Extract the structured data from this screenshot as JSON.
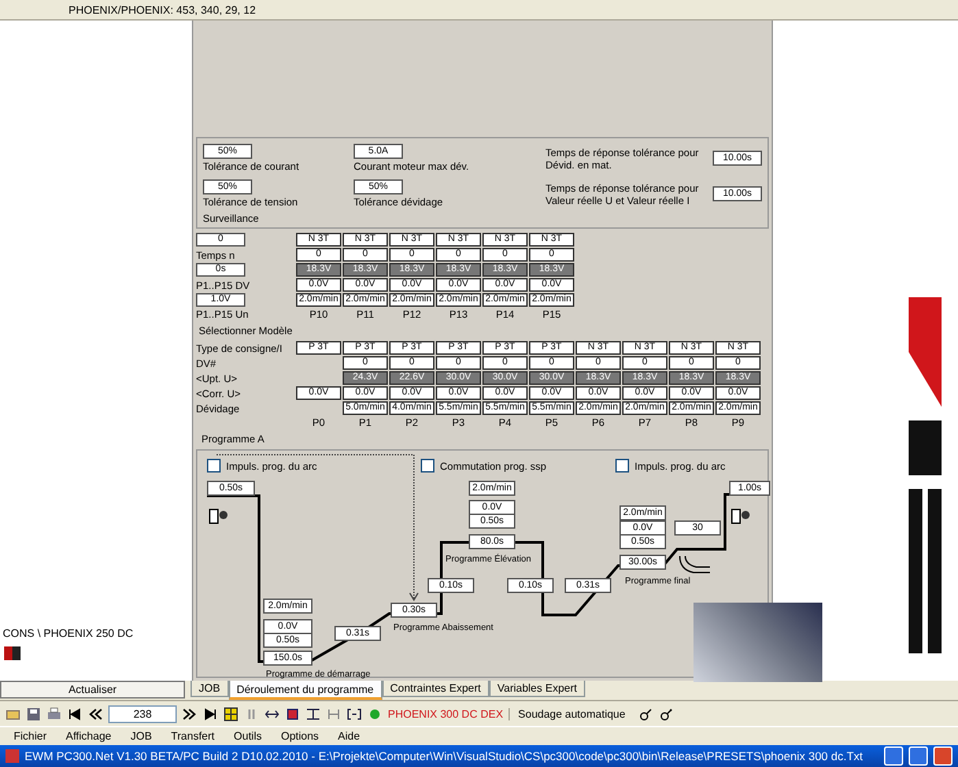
{
  "status_bar": {
    "text": "PHOENIX/PHOENIX: 453, 340, 29, 12"
  },
  "surveillance": {
    "title": "Surveillance",
    "fields": [
      {
        "label": "Tolérance de courant",
        "value": "50%"
      },
      {
        "label": "Courant moteur max dév.",
        "value": "5.0A"
      },
      {
        "label": "Temps de réponse tolérance pour Dévid. en mat.",
        "value": "10.00s"
      },
      {
        "label": "Tolérance de tension",
        "value": "50%"
      },
      {
        "label": "Tolérance dévidage",
        "value": "50%"
      },
      {
        "label": "Temps de réponse tolérance pour Valeur réelle U et Valeur réelle I",
        "value": "10.00s"
      }
    ]
  },
  "parameters_b": {
    "rows": [
      {
        "side": {
          "kind": "field",
          "text": "0"
        },
        "kind": "plain",
        "cells": [
          "N 3T",
          "N 3T",
          "N 3T",
          "N 3T",
          "N 3T",
          "N 3T"
        ]
      },
      {
        "side": {
          "kind": "label",
          "text": "Temps n"
        },
        "kind": "plain",
        "cells": [
          "0",
          "0",
          "0",
          "0",
          "0",
          "0"
        ]
      },
      {
        "side": {
          "kind": "field",
          "text": "0s"
        },
        "kind": "dark",
        "cells": [
          "18.3V",
          "18.3V",
          "18.3V",
          "18.3V",
          "18.3V",
          "18.3V"
        ]
      },
      {
        "side": {
          "kind": "label",
          "text": "P1..P15 DV"
        },
        "kind": "plain",
        "cells": [
          "0.0V",
          "0.0V",
          "0.0V",
          "0.0V",
          "0.0V",
          "0.0V"
        ]
      },
      {
        "side": {
          "kind": "field",
          "text": "1.0V"
        },
        "kind": "plain",
        "cells": [
          "2.0m/min",
          "2.0m/min",
          "2.0m/min",
          "2.0m/min",
          "2.0m/min",
          "2.0m/min"
        ]
      },
      {
        "side": {
          "kind": "label",
          "text": "P1..P15 Un"
        },
        "kind": "header",
        "cells": [
          "P10",
          "P11",
          "P12",
          "P13",
          "P14",
          "P15"
        ]
      }
    ]
  },
  "parameters": {
    "note": "Sélectionner Modèle",
    "rows": [
      {
        "label": "Type de consigne/I",
        "kind": "plain",
        "cells": [
          "P 3T",
          "P 3T",
          "P 3T",
          "P 3T",
          "P 3T",
          "P 3T",
          "N 3T",
          "N 3T",
          "N 3T",
          "N 3T"
        ]
      },
      {
        "label": "DV#",
        "kind": "plain",
        "cells": [
          null,
          "0",
          "0",
          "0",
          "0",
          "0",
          "0",
          "0",
          "0",
          "0"
        ]
      },
      {
        "label": "<Upt. U>",
        "kind": "dark",
        "cells": [
          null,
          "24.3V",
          "22.6V",
          "30.0V",
          "30.0V",
          "30.0V",
          "18.3V",
          "18.3V",
          "18.3V",
          "18.3V"
        ]
      },
      {
        "label": "<Corr. U>",
        "kind": "plain",
        "cells": [
          "0.0V",
          "0.0V",
          "0.0V",
          "0.0V",
          "0.0V",
          "0.0V",
          "0.0V",
          "0.0V",
          "0.0V",
          "0.0V"
        ]
      },
      {
        "label": "Dévidage",
        "kind": "plain",
        "cells": [
          null,
          "5.0m/min",
          "4.0m/min",
          "5.5m/min",
          "5.5m/min",
          "5.5m/min",
          "2.0m/min",
          "2.0m/min",
          "2.0m/min",
          "2.0m/min"
        ]
      },
      {
        "label": null,
        "kind": "header",
        "cells": [
          "P0",
          "P1",
          "P2",
          "P3",
          "P4",
          "P5",
          "P6",
          "P7",
          "P8",
          "P9"
        ]
      }
    ]
  },
  "sequence": {
    "title": "Programme A",
    "checkboxes": [
      {
        "label": "Impuls. prog. du arc",
        "checked": false
      },
      {
        "label": "Commutation prog. ssp",
        "checked": false
      },
      {
        "label": "Impuls. prog. du arc",
        "checked": false
      }
    ],
    "values": [
      "0.50s",
      "2.0m/min",
      "1.00s",
      "0.0V",
      "2.0m/min",
      "0.50s",
      "0.0V",
      "30",
      "80.0s",
      "0.50s",
      "30.00s",
      "0.10s",
      "0.10s",
      "0.31s",
      "2.0m/min",
      "0.30s",
      "0.0V",
      "0.31s",
      "0.50s",
      "150.0s"
    ],
    "labels": [
      "Programme Élévation",
      "Programme final",
      "Programme Abaissement",
      "Programme de démarrage"
    ]
  },
  "left_panel": {
    "device_label": "CONS \\ PHOENIX 250 DC",
    "button": "Actualiser"
  },
  "tabs": [
    {
      "label": "JOB",
      "selected": false
    },
    {
      "label": "Déroulement du programme",
      "selected": true
    },
    {
      "label": "Contraintes Expert",
      "selected": false
    },
    {
      "label": "Variables Expert",
      "selected": false
    }
  ],
  "toolbar": {
    "program_number": "238",
    "device": "PHOENIX 300 DC DEX",
    "mode": "Soudage automatique"
  },
  "menu": [
    "Fichier",
    "Affichage",
    "JOB",
    "Transfert",
    "Outils",
    "Options",
    "Aide"
  ],
  "window": {
    "title": "EWM PC300.Net V1.30 BETA/PC Build 2 D10.02.2010 - E:\\Projekte\\Computer\\Win\\VisualStudio\\CS\\pc300\\code\\pc300\\bin\\Release\\PRESETS\\phoenix 300 dc.Txt"
  }
}
